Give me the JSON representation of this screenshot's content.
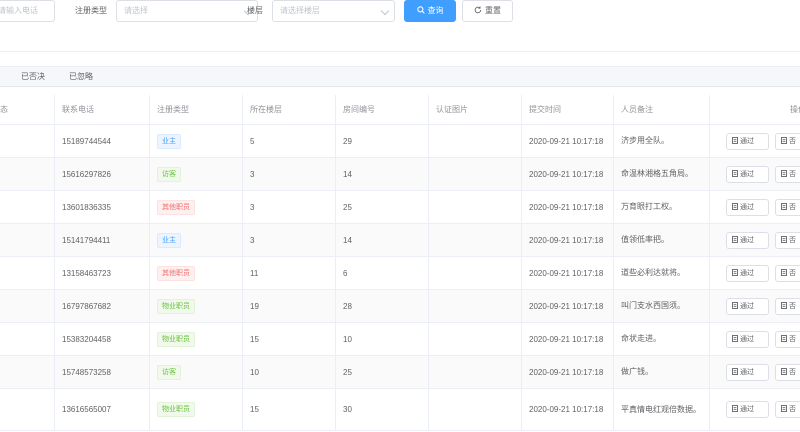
{
  "filters": {
    "phone_placeholder": "请输入电话",
    "reg_type_label": "注册类型",
    "reg_type_placeholder": "请选择",
    "floor_label": "楼层",
    "floor_placeholder": "请选择楼层",
    "query_button": "查询",
    "reset_button": "重置"
  },
  "tabs": [
    "已否决",
    "已忽略"
  ],
  "table": {
    "left_header_fragment": "态",
    "headers": {
      "phone": "联系电话",
      "reg_type": "注册类型",
      "floor": "所在楼层",
      "room": "房间编号",
      "image": "认证图片",
      "time": "提交时间",
      "remark": "人员备注",
      "actions": "操作"
    },
    "approve_label": "通过",
    "reject_label": "否",
    "rows": [
      {
        "phone": "15189744544",
        "type": "业主",
        "type_color": "blue",
        "floor": "5",
        "room": "29",
        "time": "2020-09-21 10:17:18",
        "remark": "济步用全队。"
      },
      {
        "phone": "15616297826",
        "type": "访客",
        "type_color": "green",
        "floor": "3",
        "room": "14",
        "time": "2020-09-21 10:17:18",
        "remark": "命温林湘格五角局。"
      },
      {
        "phone": "13601836335",
        "type": "其他职员",
        "type_color": "red",
        "floor": "3",
        "room": "25",
        "time": "2020-09-21 10:17:18",
        "remark": "万育眼打工权。"
      },
      {
        "phone": "15141794411",
        "type": "业主",
        "type_color": "blue",
        "floor": "3",
        "room": "14",
        "time": "2020-09-21 10:17:18",
        "remark": "值领低率把。"
      },
      {
        "phone": "13158463723",
        "type": "其他职员",
        "type_color": "red",
        "floor": "11",
        "room": "6",
        "time": "2020-09-21 10:17:18",
        "remark": "道些必利达就将。"
      },
      {
        "phone": "16797867682",
        "type": "物业职员",
        "type_color": "green",
        "floor": "19",
        "room": "28",
        "time": "2020-09-21 10:17:18",
        "remark": "叫门支水西国须。"
      },
      {
        "phone": "15383204458",
        "type": "物业职员",
        "type_color": "green",
        "floor": "15",
        "room": "10",
        "time": "2020-09-21 10:17:18",
        "remark": "命状走进。"
      },
      {
        "phone": "15748573258",
        "type": "访客",
        "type_color": "green",
        "floor": "10",
        "room": "25",
        "time": "2020-09-21 10:17:18",
        "remark": "做广钱。"
      },
      {
        "phone": "13616565007",
        "type": "物业职员",
        "type_color": "green",
        "floor": "15",
        "room": "30",
        "time": "2020-09-21 10:17:18",
        "remark": "平真情电红观倍数据。"
      }
    ]
  },
  "colors": {
    "primary": "#409eff",
    "tag_blue": "#409eff",
    "tag_green": "#67c23a",
    "tag_red": "#f56c6c"
  }
}
